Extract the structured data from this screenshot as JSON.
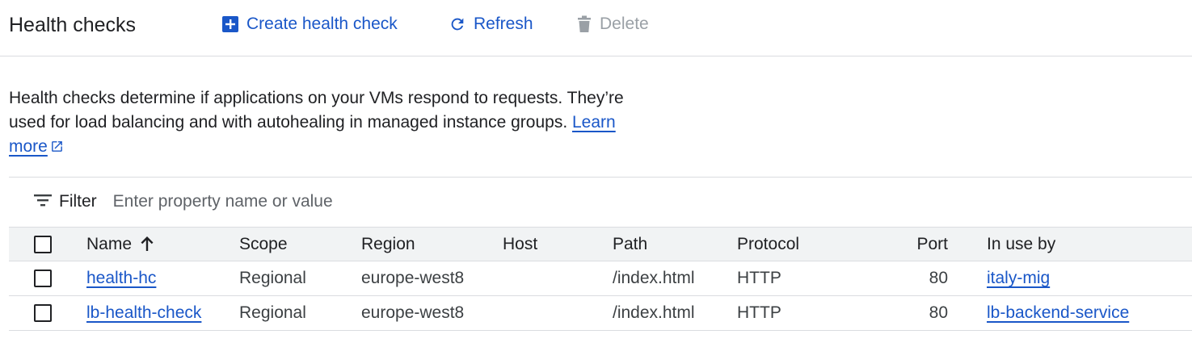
{
  "header": {
    "title": "Health checks",
    "create_label": "Create health check",
    "refresh_label": "Refresh",
    "delete_label": "Delete"
  },
  "description": {
    "text": "Health checks determine if applications on your VMs respond to requests. They’re used for load balancing and with autohealing in managed instance groups. ",
    "link_label": "Learn more"
  },
  "filter": {
    "label": "Filter",
    "placeholder": "Enter property name or value"
  },
  "table": {
    "columns": {
      "name": "Name",
      "scope": "Scope",
      "region": "Region",
      "host": "Host",
      "path": "Path",
      "protocol": "Protocol",
      "port": "Port",
      "in_use_by": "In use by"
    },
    "sort": {
      "column": "Name",
      "direction": "ascending"
    },
    "rows": [
      {
        "name": "health-hc",
        "scope": "Regional",
        "region": "europe-west8",
        "host": "",
        "path": "/index.html",
        "protocol": "HTTP",
        "port": "80",
        "in_use_by": "italy-mig"
      },
      {
        "name": "lb-health-check",
        "scope": "Regional",
        "region": "europe-west8",
        "host": "",
        "path": "/index.html",
        "protocol": "HTTP",
        "port": "80",
        "in_use_by": "lb-backend-service"
      }
    ]
  },
  "icons": {
    "create": "add-box-icon",
    "refresh": "refresh-icon",
    "delete": "trash-icon",
    "external": "external-link-icon",
    "filter": "filter-icon",
    "sort": "arrow-up-icon"
  },
  "colors": {
    "accent": "#1a57c8",
    "disabled": "#9aa0a6",
    "header_row_bg": "#f1f3f4",
    "border": "#dadce0"
  }
}
